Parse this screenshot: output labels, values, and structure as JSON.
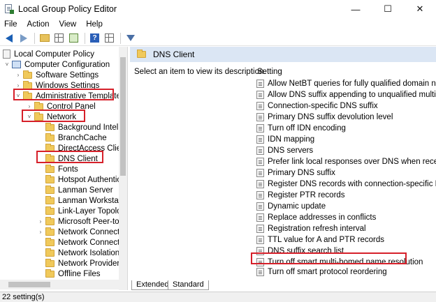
{
  "window": {
    "title": "Local Group Policy Editor",
    "controls": {
      "minimize": "—",
      "maximize": "☐",
      "close": "✕"
    }
  },
  "menu": [
    "File",
    "Action",
    "View",
    "Help"
  ],
  "tree": {
    "items": [
      {
        "label": "Local Computer Policy",
        "icon": "document-icon"
      },
      {
        "label": "Computer Configuration",
        "icon": "computer-icon",
        "expander": "˅"
      },
      {
        "label": "Software Settings",
        "icon": "folder-icon",
        "expander": "›"
      },
      {
        "label": "Windows Settings",
        "icon": "folder-icon",
        "expander": "›"
      },
      {
        "label": "Administrative Templates",
        "icon": "folder-icon",
        "expander": "˅"
      },
      {
        "label": "Control Panel",
        "icon": "folder-icon",
        "expander": "›"
      },
      {
        "label": "Network",
        "icon": "folder-icon",
        "expander": "˅"
      },
      {
        "label": "Background Intellig",
        "icon": "folder-icon"
      },
      {
        "label": "BranchCache",
        "icon": "folder-icon"
      },
      {
        "label": "DirectAccess Client E",
        "icon": "folder-icon"
      },
      {
        "label": "DNS Client",
        "icon": "folder-icon"
      },
      {
        "label": "Fonts",
        "icon": "folder-icon"
      },
      {
        "label": "Hotspot Authenticat",
        "icon": "folder-icon"
      },
      {
        "label": "Lanman Server",
        "icon": "folder-icon"
      },
      {
        "label": "Lanman Workstation",
        "icon": "folder-icon"
      },
      {
        "label": "Link-Layer Topology",
        "icon": "folder-icon"
      },
      {
        "label": "Microsoft Peer-to-P",
        "icon": "folder-icon",
        "expander": "›"
      },
      {
        "label": "Network Connection",
        "icon": "folder-icon",
        "expander": "›"
      },
      {
        "label": "Network Connectivi",
        "icon": "folder-icon"
      },
      {
        "label": "Network Isolation",
        "icon": "folder-icon"
      },
      {
        "label": "Network Provider",
        "icon": "folder-icon"
      },
      {
        "label": "Offline Files",
        "icon": "folder-icon"
      }
    ]
  },
  "detail": {
    "header": "DNS Client",
    "description": "Select an item to view its description.",
    "column_header": "Setting",
    "settings": [
      "Allow NetBT queries for fully qualified domain names",
      "Allow DNS suffix appending to unqualified multi-label",
      "Connection-specific DNS suffix",
      "Primary DNS suffix devolution level",
      "Turn off IDN encoding",
      "IDN mapping",
      "DNS servers",
      "Prefer link local responses over DNS when received ov",
      "Primary DNS suffix",
      "Register DNS records with connection-specific DNS su",
      "Register PTR records",
      "Dynamic update",
      "Replace addresses in conflicts",
      "Registration refresh interval",
      "TTL value for A and PTR records",
      "DNS suffix search list",
      "Turn off smart multi-homed name resolution",
      "Turn off smart protocol reordering"
    ]
  },
  "tabs": [
    "Extended",
    "Standard"
  ],
  "status": "22 setting(s)",
  "colors": {
    "highlight": "#d6202a",
    "header_bg": "#dbe6f4",
    "folder": "#f0c95b"
  }
}
